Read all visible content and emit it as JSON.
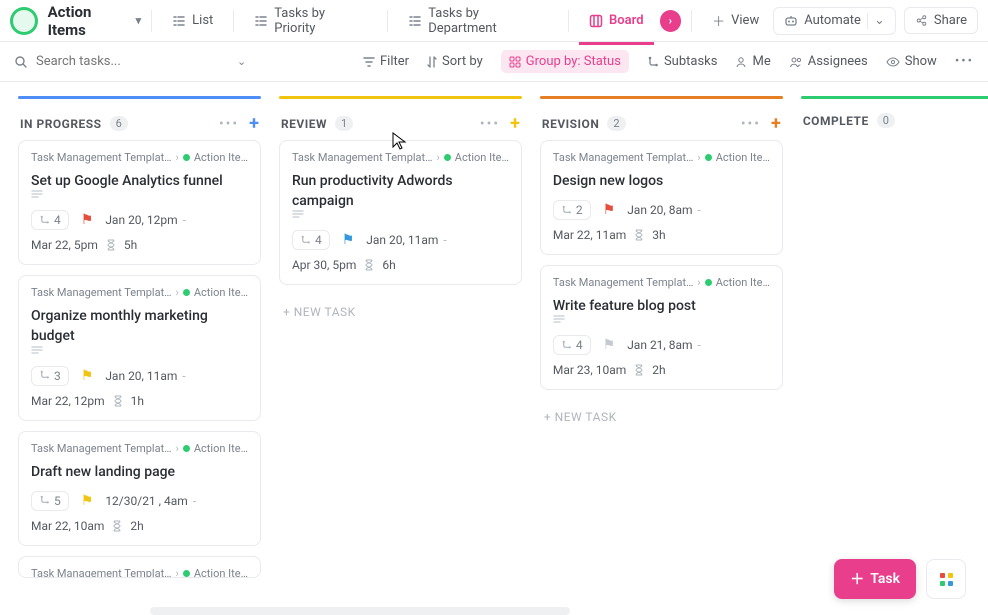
{
  "header": {
    "space_name": "Action Items",
    "views": [
      {
        "label": "List",
        "icon": "list-icon"
      },
      {
        "label": "Tasks by Priority",
        "icon": "list-icon"
      },
      {
        "label": "Tasks by Department",
        "icon": "list-icon"
      },
      {
        "label": "Board",
        "icon": "board-icon",
        "active": true
      },
      {
        "label": "View",
        "icon": "plus-icon"
      }
    ],
    "automate_label": "Automate",
    "share_label": "Share"
  },
  "filterbar": {
    "search_placeholder": "Search tasks...",
    "filter_label": "Filter",
    "sort_label": "Sort by",
    "group_label": "Group by: Status",
    "subtasks_label": "Subtasks",
    "me_label": "Me",
    "assignees_label": "Assignees",
    "show_label": "Show"
  },
  "columns": [
    {
      "id": "in_progress",
      "title": "IN PROGRESS",
      "count": "6",
      "color": "#4f8ef7",
      "plus_color": "#4f8ef7",
      "cards": [
        {
          "breadcrumb_a": "Task Management Templat…",
          "breadcrumb_b": "Action Ite…",
          "title": "Set up Google Analytics funnel",
          "has_desc": true,
          "subtasks": "4",
          "flag": "red",
          "due": "Jan 20, 12pm",
          "tracked_date": "Mar 22, 5pm",
          "estimate": "5h"
        },
        {
          "breadcrumb_a": "Task Management Templat…",
          "breadcrumb_b": "Action Ite…",
          "title": "Organize monthly marketing budget",
          "has_desc": true,
          "subtasks": "3",
          "flag": "yellow",
          "due": "Jan 20, 11am",
          "tracked_date": "Mar 22, 12pm",
          "estimate": "1h"
        },
        {
          "breadcrumb_a": "Task Management Templat…",
          "breadcrumb_b": "Action Ite…",
          "title": "Draft new landing page",
          "has_desc": false,
          "subtasks": "5",
          "flag": "yellow",
          "due": "12/30/21 , 4am",
          "tracked_date": "Mar 22, 10am",
          "estimate": "2h"
        },
        {
          "breadcrumb_a": "Task Management Templat…",
          "breadcrumb_b": "Action Ite…",
          "title": "",
          "peek": true
        }
      ]
    },
    {
      "id": "review",
      "title": "REVIEW",
      "count": "1",
      "color": "#f1c40f",
      "plus_color": "#f1c40f",
      "new_task_label": "+ NEW TASK",
      "cards": [
        {
          "breadcrumb_a": "Task Management Templat…",
          "breadcrumb_b": "Action Ite…",
          "title": "Run productivity Adwords campaign",
          "has_desc": true,
          "subtasks": "4",
          "flag": "blue",
          "due": "Jan 20, 11am",
          "tracked_date": "Apr 30, 5pm",
          "estimate": "6h"
        }
      ]
    },
    {
      "id": "revision",
      "title": "REVISION",
      "count": "2",
      "color": "#e67e22",
      "plus_color": "#e67e22",
      "new_task_label": "+ NEW TASK",
      "cards": [
        {
          "breadcrumb_a": "Task Management Templat…",
          "breadcrumb_b": "Action Ite…",
          "title": "Design new logos",
          "has_desc": false,
          "subtasks": "2",
          "flag": "red",
          "due": "Jan 20, 8am",
          "tracked_date": "Mar 22, 11am",
          "estimate": "3h"
        },
        {
          "breadcrumb_a": "Task Management Templat…",
          "breadcrumb_b": "Action Ite…",
          "title": "Write feature blog post",
          "has_desc": true,
          "subtasks": "4",
          "flag": "grey",
          "due": "Jan 21, 8am",
          "tracked_date": "Mar 23, 10am",
          "estimate": "2h"
        }
      ]
    },
    {
      "id": "complete",
      "title": "COMPLETE",
      "count": "0",
      "color": "#2ecc71",
      "plus_color": "#2ecc71",
      "cards": []
    }
  ],
  "fab": {
    "task_label": "Task"
  }
}
